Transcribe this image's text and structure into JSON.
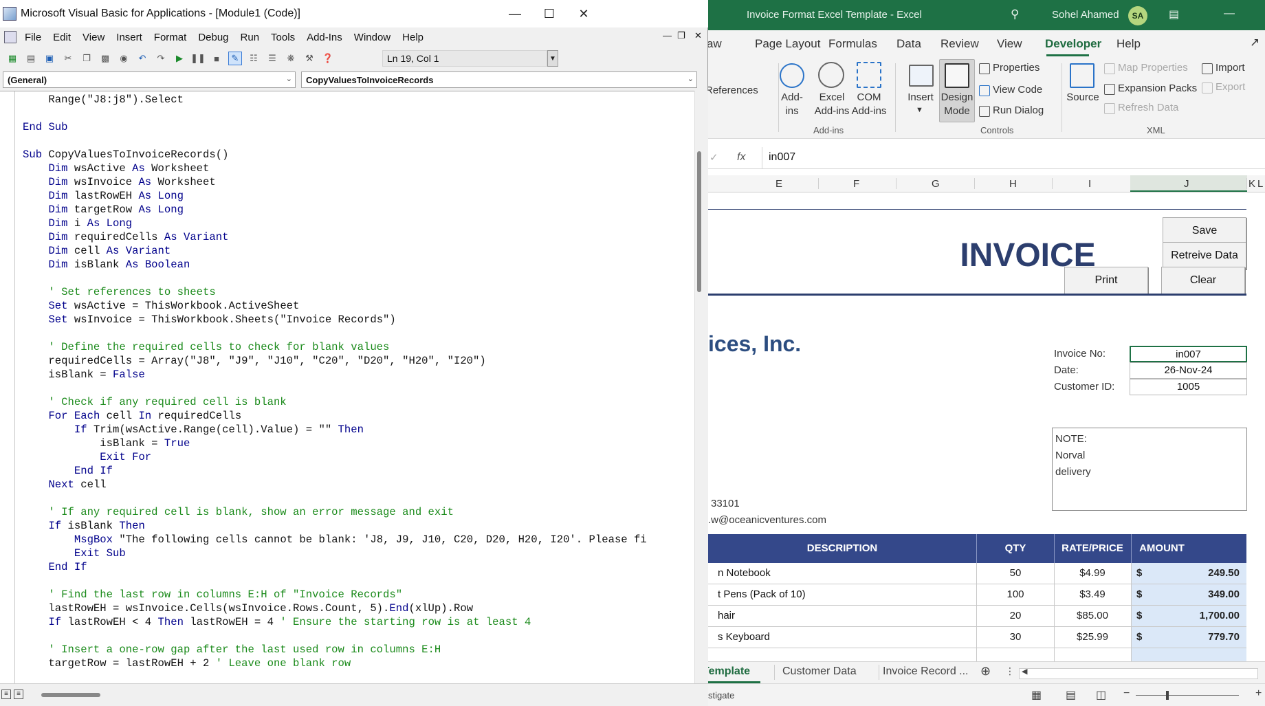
{
  "vba": {
    "title": "Microsoft Visual Basic for Applications - [Module1 (Code)]",
    "menu": [
      "File",
      "Edit",
      "View",
      "Insert",
      "Format",
      "Debug",
      "Run",
      "Tools",
      "Add-Ins",
      "Window",
      "Help"
    ],
    "cursor_position": "Ln 19, Col 1",
    "object_combo": "(General)",
    "procedure_combo": "CopyValuesToInvoiceRecords",
    "code_lines": [
      "    Range(\"J8:j8\").Select",
      "",
      "End Sub",
      "",
      "Sub CopyValuesToInvoiceRecords()",
      "    Dim wsActive As Worksheet",
      "    Dim wsInvoice As Worksheet",
      "    Dim lastRowEH As Long",
      "    Dim targetRow As Long",
      "    Dim i As Long",
      "    Dim requiredCells As Variant",
      "    Dim cell As Variant",
      "    Dim isBlank As Boolean",
      "",
      "    ' Set references to sheets",
      "    Set wsActive = ThisWorkbook.ActiveSheet",
      "    Set wsInvoice = ThisWorkbook.Sheets(\"Invoice Records\")",
      "",
      "    ' Define the required cells to check for blank values",
      "    requiredCells = Array(\"J8\", \"J9\", \"J10\", \"C20\", \"D20\", \"H20\", \"I20\")",
      "    isBlank = False",
      "",
      "    ' Check if any required cell is blank",
      "    For Each cell In requiredCells",
      "        If Trim(wsActive.Range(cell).Value) = \"\" Then",
      "            isBlank = True",
      "            Exit For",
      "        End If",
      "    Next cell",
      "",
      "    ' If any required cell is blank, show an error message and exit",
      "    If isBlank Then",
      "        MsgBox \"The following cells cannot be blank: 'J8, J9, J10, C20, D20, H20, I20'. Please fi",
      "        Exit Sub",
      "    End If",
      "",
      "    ' Find the last row in columns E:H of \"Invoice Records\"",
      "    lastRowEH = wsInvoice.Cells(wsInvoice.Rows.Count, 5).End(xlUp).Row",
      "    If lastRowEH < 4 Then lastRowEH = 4 ' Ensure the starting row is at least 4",
      "",
      "    ' Insert a one-row gap after the last used row in columns E:H",
      "    targetRow = lastRowEH + 2 ' Leave one blank row"
    ]
  },
  "excel": {
    "title": "Invoice Format Excel Template  -  Excel",
    "user_name": "Sohel Ahamed",
    "user_initials": "SA",
    "tabs": [
      "Draw",
      "Page Layout",
      "Formulas",
      "Data",
      "Review",
      "View",
      "Developer",
      "Help"
    ],
    "active_tab": "Developer",
    "ribbon": {
      "references_partial": "References",
      "addins_label": "Add-\nins",
      "excel_addins_label": "Excel\nAdd-ins",
      "com_addins_label": "COM\nAdd-ins",
      "group_addins": "Add-ins",
      "insert_label": "Insert",
      "design_mode_label": "Design\nMode",
      "properties": "Properties",
      "view_code": "View Code",
      "run_dialog": "Run Dialog",
      "group_controls": "Controls",
      "source": "Source",
      "map_properties": "Map Properties",
      "expansion_packs": "Expansion Packs",
      "refresh_data": "Refresh Data",
      "import": "Import",
      "export": "Export",
      "group_xml": "XML"
    },
    "formula_value": "in007",
    "columns": [
      "E",
      "F",
      "G",
      "H",
      "I",
      "J",
      "K",
      "L"
    ],
    "buttons": {
      "save": "Save",
      "retrieve": "Retreive Data",
      "print": "Print",
      "clear": "Clear"
    },
    "invoice_title": "INVOICE",
    "company_partial": "ices, Inc.",
    "fields": {
      "invoice_no_label": "Invoice No:",
      "invoice_no": "in007",
      "date_label": "Date:",
      "date": "26-Nov-24",
      "customer_id_label": "Customer ID:",
      "customer_id": "1005"
    },
    "note": {
      "label": "NOTE:",
      "line1": "Norval",
      "line2": "delivery"
    },
    "contact": {
      "zip_partial": "33101",
      "email_partial": ".w@oceanicventures.com"
    },
    "table_headers": [
      "DESCRIPTION",
      "QTY",
      "RATE/PRICE",
      "AMOUNT"
    ],
    "items": [
      {
        "desc": "n Notebook",
        "qty": "50",
        "rate": "$4.99",
        "cur": "$",
        "amount": "249.50"
      },
      {
        "desc": "t Pens (Pack of 10)",
        "qty": "100",
        "rate": "$3.49",
        "cur": "$",
        "amount": "349.00"
      },
      {
        "desc": "hair",
        "qty": "20",
        "rate": "$85.00",
        "cur": "$",
        "amount": "1,700.00"
      },
      {
        "desc": "s Keyboard",
        "qty": "30",
        "rate": "$25.99",
        "cur": "$",
        "amount": "779.70"
      }
    ],
    "sheet_tabs": [
      "Template",
      "Customer Data",
      "Invoice Record ..."
    ],
    "active_sheet": "Template",
    "status_partial": "stigate"
  },
  "colors": {
    "excel_green": "#1e7145",
    "invoice_navy": "#2c3e6e",
    "header_navy": "#34488a",
    "amount_fill": "#dbe8f8"
  }
}
